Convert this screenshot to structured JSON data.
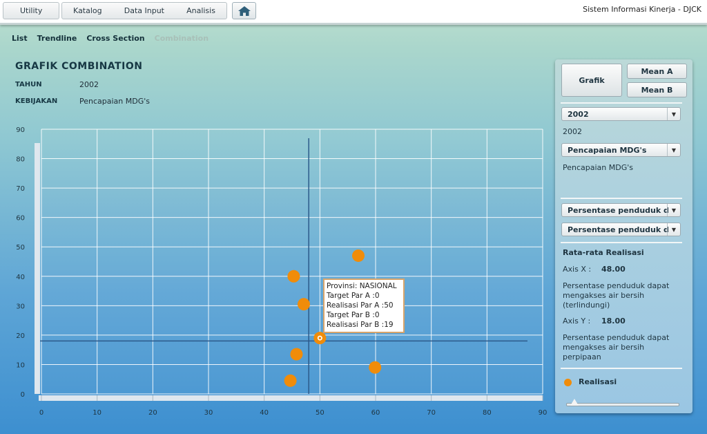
{
  "topbar": {
    "utility_label": "Utility",
    "menu": [
      "Katalog",
      "Data Input",
      "Analisis"
    ],
    "home_icon": "home-icon",
    "app_title": "Sistem Informasi Kinerja - DJCK"
  },
  "subtabs": [
    "List",
    "Trendline",
    "Cross Section",
    "Combination"
  ],
  "header": {
    "title": "GRAFIK COMBINATION",
    "tahun_label": "TAHUN",
    "tahun_value": "2002",
    "kebijakan_label": "KEBIJAKAN",
    "kebijakan_value": "Pencapaian MDG's"
  },
  "chart_data": {
    "type": "scatter",
    "xlim": [
      0,
      90
    ],
    "ylim": [
      0,
      90
    ],
    "x_ticks": [
      0,
      10,
      20,
      30,
      40,
      50,
      60,
      70,
      80,
      90
    ],
    "y_ticks": [
      0,
      10,
      20,
      30,
      40,
      50,
      60,
      70,
      80,
      90
    ],
    "grid": true,
    "mean_x": 48,
    "mean_y": 18,
    "color": "#f08c0a",
    "points": [
      {
        "x": 44.7,
        "y": 4.5
      },
      {
        "x": 45.8,
        "y": 13.5
      },
      {
        "x": 45.3,
        "y": 40
      },
      {
        "x": 47.1,
        "y": 30.5
      },
      {
        "x": 50,
        "y": 19,
        "selected": true
      },
      {
        "x": 56.9,
        "y": 47
      },
      {
        "x": 59.9,
        "y": 9
      }
    ]
  },
  "tooltip": {
    "lines": [
      "Provinsi: NASIONAL",
      "Target Par A :0",
      "Realisasi Par A :50",
      "Target Par B :0",
      "Realisasi Par B :19"
    ]
  },
  "panel": {
    "grafik_button": "Grafik",
    "mean_a_button": "Mean A",
    "mean_b_button": "Mean B",
    "year_select": "2002",
    "year_text": "2002",
    "policy_select": "Pencapaian MDG's",
    "policy_text": "Pencapaian MDG's",
    "param_a_select": "Persentase penduduk d",
    "param_b_select": "Persentase penduduk d",
    "section_title": "Rata-rata Realisasi",
    "axis_x_label": "Axis X :",
    "axis_x_value": "48.00",
    "axis_x_desc": "Persentase penduduk dapat mengakses air bersih (terlindungi)",
    "axis_y_label": "Axis Y :",
    "axis_y_value": "18.00",
    "axis_y_desc": "Persentase penduduk dapat mengakses air bersih perpipaan",
    "legend_label": "Realisasi",
    "dropdown_icon": "chevron-down-icon"
  }
}
